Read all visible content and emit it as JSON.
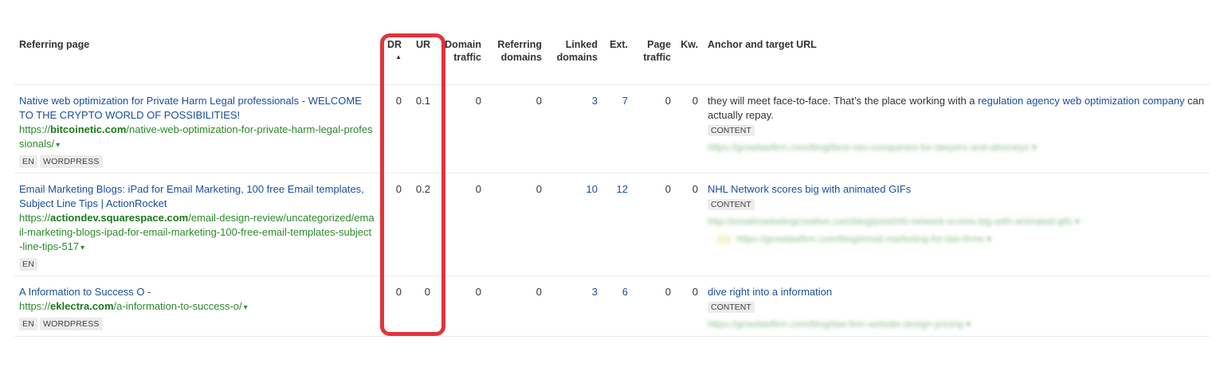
{
  "columns": {
    "referring_page": "Referring page",
    "dr": "DR",
    "dr_sort": "▲",
    "ur": "UR",
    "domain_traffic_1": "Domain",
    "domain_traffic_2": "traffic",
    "referring_domains_1": "Referring",
    "referring_domains_2": "domains",
    "linked_domains_1": "Linked",
    "linked_domains_2": "domains",
    "ext": "Ext.",
    "page_traffic_1": "Page",
    "page_traffic_2": "traffic",
    "kw": "Kw.",
    "anchor": "Anchor and target URL"
  },
  "rows": [
    {
      "title": "Native web optimization for Private Harm Legal professionals - WELCOME TO THE CRYPTO WORLD OF POSSIBILITIES!",
      "url_prefix": "https://",
      "url_domain": "bitcoinetic.com",
      "url_path": "/native-web-optimization-for-private-harm-legal-professionals/",
      "caret": "▾",
      "tag1": "EN",
      "tag2": "WORDPRESS",
      "dr": "0",
      "ur": "0.1",
      "domain_traffic": "0",
      "referring_domains": "0",
      "linked_domains": "3",
      "ext": "7",
      "page_traffic": "0",
      "kw": "0",
      "anchor_before": "they will meet face-to-face. That’s the place working with a ",
      "anchor_link": "regulation agency web optimization company",
      "anchor_after": " can actually repay.",
      "content_tag": "CONTENT",
      "blur1": "https://growlawfirm.com/blog/best-seo-companies-for-lawyers-and-attorneys ▾"
    },
    {
      "title": "Email Marketing Blogs: iPad for Email Marketing, 100 free Email templates, Subject Line Tips | ActionRocket",
      "url_prefix": "https://",
      "url_domain": "actiondev.squarespace.com",
      "url_path": "/email-design-review/uncategorized/email-marketing-blogs-ipad-for-email-marketing-100-free-email-templates-subject-line-tips-517",
      "caret": "▾",
      "tag1": "EN",
      "dr": "0",
      "ur": "0.2",
      "domain_traffic": "0",
      "referring_domains": "0",
      "linked_domains": "10",
      "ext": "12",
      "page_traffic": "0",
      "kw": "0",
      "anchor_link": "NHL Network scores big with animated GIFs",
      "content_tag": "CONTENT",
      "blur1": "http://emailmarketingcreative.com/blog/post/nhl-network-scores-big-with-animated-gifs ▾",
      "blur2": "https://growlawfirm.com/blog/email-marketing-for-law-firms ▾"
    },
    {
      "title": "A Information to Success O -",
      "url_prefix": "https://",
      "url_domain": "eklectra.com",
      "url_path": "/a-information-to-success-o/",
      "caret": "▾",
      "tag1": "EN",
      "tag2": "WORDPRESS",
      "dr": "0",
      "ur": "0",
      "domain_traffic": "0",
      "referring_domains": "0",
      "linked_domains": "3",
      "ext": "6",
      "page_traffic": "0",
      "kw": "0",
      "anchor_link": "dive right into a information",
      "content_tag": "CONTENT",
      "blur1": "https://growlawfirm.com/blog/law-firm-website-design-pricing ▾"
    }
  ],
  "colors": {
    "link": "#1a4d9c",
    "url": "#2a8a2a",
    "highlight": "#e0353b"
  }
}
